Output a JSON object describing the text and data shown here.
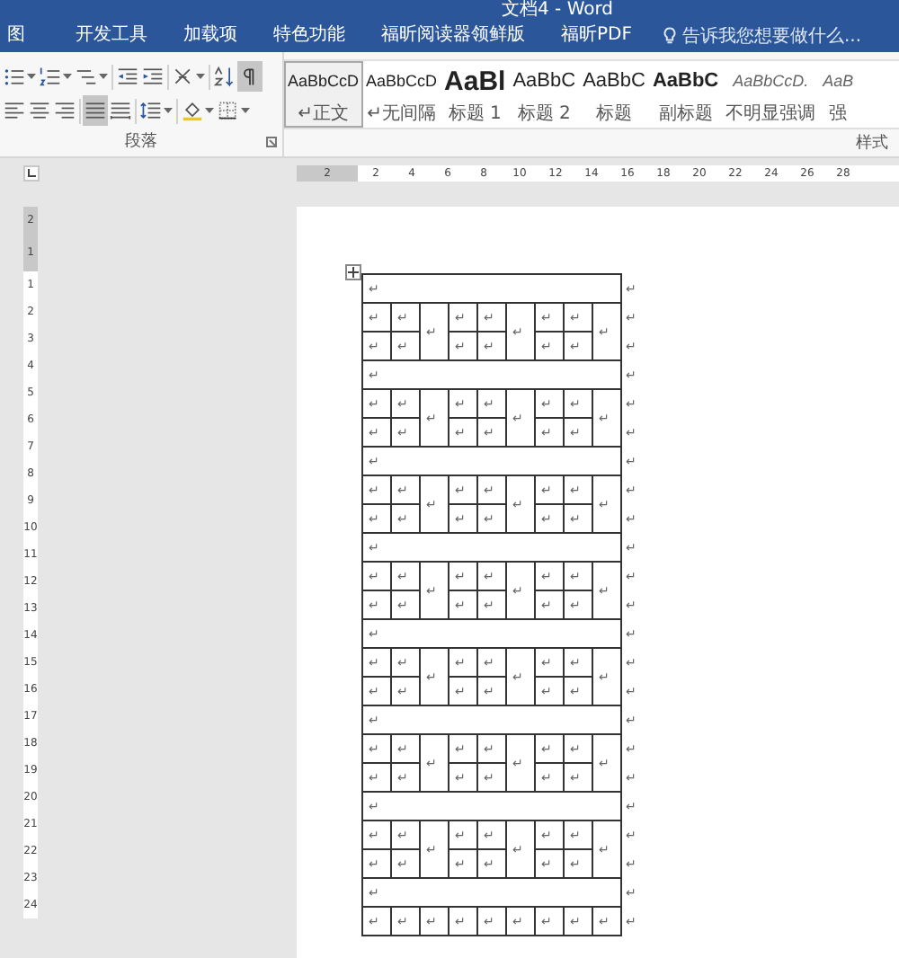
{
  "window": {
    "title": "文档4 - Word"
  },
  "tabs": [
    {
      "label": "图",
      "selected": false
    },
    {
      "label": "开发工具",
      "selected": false
    },
    {
      "label": "加载项",
      "selected": false
    },
    {
      "label": "特色功能",
      "selected": false
    },
    {
      "label": "福昕阅读器领鲜版",
      "selected": false
    },
    {
      "label": "福昕PDF",
      "selected": false
    }
  ],
  "tell_me": {
    "placeholder": "告诉我您想要做什么..."
  },
  "paragraph": {
    "label": "段落",
    "rows": [
      [
        {
          "kind": "bullets",
          "selected": false
        },
        {
          "kind": "numbering",
          "selected": false
        },
        {
          "kind": "multilevel",
          "selected": false
        },
        {
          "kind": "outdent",
          "selected": false
        },
        {
          "kind": "indent",
          "selected": false
        },
        {
          "kind": "asian",
          "selected": false
        },
        {
          "kind": "sort",
          "selected": false
        },
        {
          "kind": "marks",
          "selected": true
        }
      ],
      [
        {
          "kind": "left",
          "selected": false
        },
        {
          "kind": "center",
          "selected": false
        },
        {
          "kind": "right",
          "selected": false
        },
        {
          "kind": "justify",
          "selected": true
        },
        {
          "kind": "distribute",
          "selected": false
        },
        {
          "kind": "spacing",
          "selected": false
        },
        {
          "kind": "shading",
          "selected": false
        },
        {
          "kind": "borders",
          "selected": false
        }
      ]
    ]
  },
  "styles": {
    "label": "样式",
    "items": [
      {
        "kind": "body",
        "preview": "AaBbCcD",
        "name": "↵正文",
        "selected": true
      },
      {
        "kind": "body",
        "preview": "AaBbCcD",
        "name": "↵无间隔",
        "selected": false
      },
      {
        "kind": "heading1",
        "preview": "AaBl",
        "name": "标题 1",
        "selected": false
      },
      {
        "kind": "heading2",
        "preview": "AaBbC",
        "name": "标题 2",
        "selected": false
      },
      {
        "kind": "heading2",
        "preview": "AaBbC",
        "name": "标题",
        "selected": false
      },
      {
        "kind": "subtitle",
        "preview": "AaBbC",
        "name": "副标题",
        "selected": false
      },
      {
        "kind": "emphasis",
        "preview": "AaBbCcD.",
        "name": "不明显强调",
        "selected": false
      },
      {
        "kind": "emphasis",
        "preview": "AaB",
        "name": "强",
        "selected": false
      }
    ]
  },
  "ruler": {
    "horizontal": [
      {
        "label": "2",
        "margin": true
      },
      {
        "label": "2",
        "margin": false
      },
      {
        "label": "4",
        "margin": false
      },
      {
        "label": "6",
        "margin": false
      },
      {
        "label": "8",
        "margin": false
      },
      {
        "label": "10",
        "margin": false
      },
      {
        "label": "12",
        "margin": false
      },
      {
        "label": "14",
        "margin": false
      },
      {
        "label": "16",
        "margin": false
      },
      {
        "label": "18",
        "margin": false
      },
      {
        "label": "20",
        "margin": false
      },
      {
        "label": "22",
        "margin": false
      },
      {
        "label": "24",
        "margin": false
      },
      {
        "label": "26",
        "margin": false
      },
      {
        "label": "28",
        "margin": false
      }
    ],
    "vertical": [
      {
        "label": "2",
        "margin": true
      },
      {
        "label": "1",
        "margin": true
      },
      {
        "label": "1",
        "margin": false
      },
      {
        "label": "2",
        "margin": false
      },
      {
        "label": "3",
        "margin": false
      },
      {
        "label": "4",
        "margin": false
      },
      {
        "label": "5",
        "margin": false
      },
      {
        "label": "6",
        "margin": false
      },
      {
        "label": "7",
        "margin": false
      },
      {
        "label": "8",
        "margin": false
      },
      {
        "label": "9",
        "margin": false
      },
      {
        "label": "10",
        "margin": false
      },
      {
        "label": "11",
        "margin": false
      },
      {
        "label": "12",
        "margin": false
      },
      {
        "label": "13",
        "margin": false
      },
      {
        "label": "14",
        "margin": false
      },
      {
        "label": "15",
        "margin": false
      },
      {
        "label": "16",
        "margin": false
      },
      {
        "label": "17",
        "margin": false
      },
      {
        "label": "18",
        "margin": false
      },
      {
        "label": "19",
        "margin": false
      },
      {
        "label": "20",
        "margin": false
      },
      {
        "label": "21",
        "margin": false
      },
      {
        "label": "22",
        "margin": false
      },
      {
        "label": "23",
        "margin": false
      },
      {
        "label": "24",
        "margin": false
      }
    ]
  },
  "table": {
    "rows": [
      {
        "cells": [
          {
            "text": "↵",
            "colspan": 9
          }
        ],
        "end_mark": "↵"
      },
      {
        "cells": [
          "↵",
          "↵",
          {
            "text": "↵",
            "rowspan": 2
          },
          "↵",
          "↵",
          {
            "text": "↵",
            "rowspan": 2
          },
          "↵",
          "↵",
          {
            "text": "↵",
            "rowspan": 2
          }
        ],
        "end_mark": "↵"
      },
      {
        "cells": [
          "↵",
          "↵",
          "↵",
          "↵",
          "↵",
          "↵"
        ],
        "end_mark": "↵"
      },
      {
        "cells": [
          {
            "text": "↵",
            "colspan": 9
          }
        ],
        "end_mark": "↵"
      },
      {
        "cells": [
          "↵",
          "↵",
          {
            "text": "↵",
            "rowspan": 2
          },
          "↵",
          "↵",
          {
            "text": "↵",
            "rowspan": 2
          },
          "↵",
          "↵",
          {
            "text": "↵",
            "rowspan": 2
          }
        ],
        "end_mark": "↵"
      },
      {
        "cells": [
          "↵",
          "↵",
          "↵",
          "↵",
          "↵",
          "↵"
        ],
        "end_mark": "↵"
      },
      {
        "cells": [
          {
            "text": "↵",
            "colspan": 9
          }
        ],
        "end_mark": "↵"
      },
      {
        "cells": [
          "↵",
          "↵",
          {
            "text": "↵",
            "rowspan": 2
          },
          "↵",
          "↵",
          {
            "text": "↵",
            "rowspan": 2
          },
          "↵",
          "↵",
          {
            "text": "↵",
            "rowspan": 2
          }
        ],
        "end_mark": "↵"
      },
      {
        "cells": [
          "↵",
          "↵",
          "↵",
          "↵",
          "↵",
          "↵"
        ],
        "end_mark": "↵"
      },
      {
        "cells": [
          {
            "text": "↵",
            "colspan": 9
          }
        ],
        "end_mark": "↵"
      },
      {
        "cells": [
          "↵",
          "↵",
          {
            "text": "↵",
            "rowspan": 2
          },
          "↵",
          "↵",
          {
            "text": "↵",
            "rowspan": 2
          },
          "↵",
          "↵",
          {
            "text": "↵",
            "rowspan": 2
          }
        ],
        "end_mark": "↵"
      },
      {
        "cells": [
          "↵",
          "↵",
          "↵",
          "↵",
          "↵",
          "↵"
        ],
        "end_mark": "↵"
      },
      {
        "cells": [
          {
            "text": "↵",
            "colspan": 9
          }
        ],
        "end_mark": "↵"
      },
      {
        "cells": [
          "↵",
          "↵",
          {
            "text": "↵",
            "rowspan": 2
          },
          "↵",
          "↵",
          {
            "text": "↵",
            "rowspan": 2
          },
          "↵",
          "↵",
          {
            "text": "↵",
            "rowspan": 2
          }
        ],
        "end_mark": "↵"
      },
      {
        "cells": [
          "↵",
          "↵",
          "↵",
          "↵",
          "↵",
          "↵"
        ],
        "end_mark": "↵"
      },
      {
        "cells": [
          {
            "text": "↵",
            "colspan": 9
          }
        ],
        "end_mark": "↵"
      },
      {
        "cells": [
          "↵",
          "↵",
          {
            "text": "↵",
            "rowspan": 2
          },
          "↵",
          "↵",
          {
            "text": "↵",
            "rowspan": 2
          },
          "↵",
          "↵",
          {
            "text": "↵",
            "rowspan": 2
          }
        ],
        "end_mark": "↵"
      },
      {
        "cells": [
          "↵",
          "↵",
          "↵",
          "↵",
          "↵",
          "↵"
        ],
        "end_mark": "↵"
      },
      {
        "cells": [
          {
            "text": "↵",
            "colspan": 9
          }
        ],
        "end_mark": "↵"
      },
      {
        "cells": [
          "↵",
          "↵",
          {
            "text": "↵",
            "rowspan": 2
          },
          "↵",
          "↵",
          {
            "text": "↵",
            "rowspan": 2
          },
          "↵",
          "↵",
          {
            "text": "↵",
            "rowspan": 2
          }
        ],
        "end_mark": "↵"
      },
      {
        "cells": [
          "↵",
          "↵",
          "↵",
          "↵",
          "↵",
          "↵"
        ],
        "end_mark": "↵"
      },
      {
        "cells": [
          {
            "text": "↵",
            "colspan": 9
          }
        ],
        "end_mark": "↵"
      },
      {
        "cells": [
          "↵",
          "↵",
          "↵",
          "↵",
          "↵",
          "↵",
          "↵",
          "↵",
          "↵"
        ],
        "end_mark": "↵"
      }
    ]
  }
}
